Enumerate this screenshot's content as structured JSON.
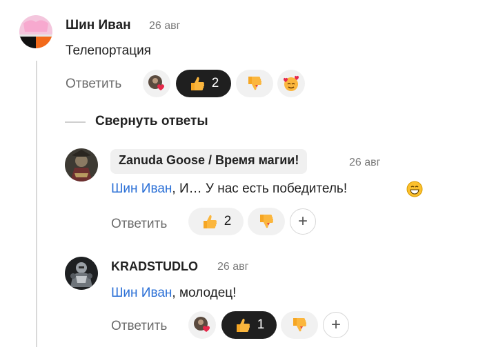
{
  "comment": {
    "author": "Шин Иван",
    "date": "26 авг",
    "text": "Телепортация",
    "reply_label": "Ответить",
    "reactions": [
      {
        "icon": "avatar-heart-reaction-icon",
        "count": ""
      },
      {
        "icon": "thumbs-up-icon",
        "count": "2",
        "active": true
      },
      {
        "icon": "thumbs-down-icon",
        "count": ""
      },
      {
        "icon": "smiling-hearts-emoji-icon",
        "count": ""
      }
    ]
  },
  "collapse_label": "Свернуть ответы",
  "replies": [
    {
      "author": "Zanuda Goose / Время магии!",
      "date": "26 авг",
      "mention": "Шин Иван",
      "text": ", И… У нас есть победитель!",
      "reply_label": "Ответить",
      "reactions": [
        {
          "icon": "thumbs-up-icon",
          "count": "2"
        },
        {
          "icon": "thumbs-down-icon",
          "count": ""
        }
      ]
    },
    {
      "author": "KRADSTUDLO",
      "date": "26 авг",
      "mention": "Шин Иван",
      "text": ", молодец!",
      "reply_label": "Ответить",
      "reactions": [
        {
          "icon": "avatar-heart-reaction-icon",
          "count": ""
        },
        {
          "icon": "thumbs-up-icon",
          "count": "1",
          "active": true
        },
        {
          "icon": "thumbs-down-icon",
          "count": ""
        }
      ]
    }
  ],
  "colors": {
    "mention": "#2a6fd6",
    "active_chip": "#1f1f1f",
    "chip": "#f1f1f1"
  }
}
